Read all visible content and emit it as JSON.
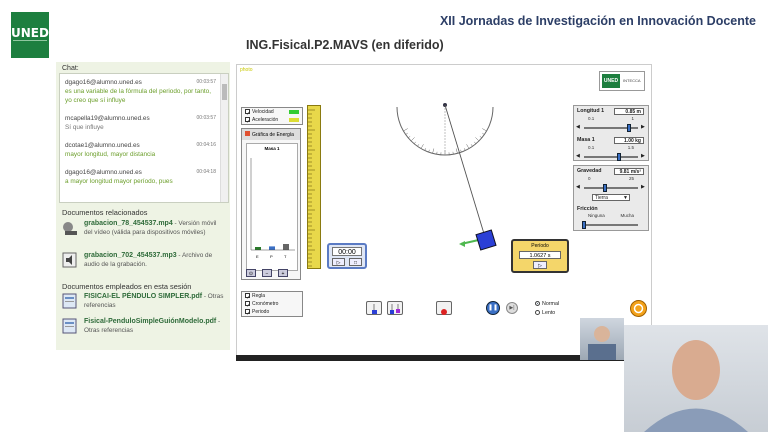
{
  "header": {
    "logo_text": "UNED",
    "event_title": "XII Jornadas de Investigación en Innovación Docente",
    "page_title": "ING.Fisical.P2.MAVS (en diferido)"
  },
  "chat": {
    "label": "Chat:",
    "messages": [
      {
        "user": "dgago16@alumno.uned.es",
        "time": "00:03:57",
        "text": "es una variable de la fórmula del periodo, por tanto, yo creo que sí influye",
        "style": "green"
      },
      {
        "user": "mcapella19@alumno.uned.es",
        "time": "00:03:57",
        "text": "Sí que influye",
        "style": "gray"
      },
      {
        "user": "dcotae1@alumno.uned.es",
        "time": "00:04:16",
        "text": "mayor longitud, mayor distancia",
        "style": "green"
      },
      {
        "user": "dgago16@alumno.uned.es",
        "time": "00:04:18",
        "text": "a mayor longitud mayor período, pues",
        "style": "green"
      }
    ]
  },
  "related_docs": {
    "title": "Documentos relacionados",
    "items": [
      {
        "name": "grabacion_78_454537.mp4",
        "desc": " - Versión móvil del vídeo (válida para dispositivos móviles)",
        "icon": "video-file-icon"
      },
      {
        "name": "grabacion_702_454537.mp3",
        "desc": " - Archivo de audio de la grabación.",
        "icon": "audio-file-icon"
      }
    ]
  },
  "session_docs": {
    "title": "Documentos empleados en esta sesión",
    "items": [
      {
        "name": "FISICAI-EL PÉNDULO SIMPLER.pdf",
        "desc": " - Otras referencias",
        "icon": "pdf-file-icon"
      },
      {
        "name": "Fisical-PenduloSimpleGuiónModelo.pdf",
        "desc": " - Otras referencias",
        "icon": "pdf-file-icon"
      }
    ]
  },
  "simulation": {
    "corner_text": "photo",
    "logo_a": "UNED",
    "logo_b": "INTECCA",
    "vectors": [
      {
        "label": "Velocidad",
        "checked": true,
        "color": "#33cc33"
      },
      {
        "label": "Aceleración",
        "checked": true,
        "color": "#dddd33"
      }
    ],
    "energy": {
      "label": "Gráfica de Energía",
      "plot_title": "Masa 1",
      "bars": [
        {
          "label": "E",
          "value": 0.05
        },
        {
          "label": "P",
          "value": 0.06
        },
        {
          "label": "T",
          "value": 0.1
        }
      ]
    },
    "tools": [
      {
        "label": "Regla",
        "checked": true
      },
      {
        "label": "Cronómetro",
        "checked": true
      },
      {
        "label": "Periodo",
        "checked": true
      }
    ],
    "timer": {
      "display": "00:00",
      "btn_start": "▷",
      "btn_reset": "□"
    },
    "period": {
      "label": "Período",
      "value": "1.0627 s",
      "btn": "▷"
    },
    "length": {
      "label": "Longitud 1",
      "value": "0.85 m",
      "min": "0.1",
      "max": "1",
      "fraction": 0.83
    },
    "mass": {
      "label": "Masa 1",
      "value": "1.00 kg",
      "min": "0.1",
      "max": "1.5",
      "fraction": 0.64
    },
    "gravity": {
      "label": "Gravedad",
      "value": "9.81 m/s²",
      "min": "0",
      "max": "25",
      "fraction": 0.39,
      "select": "Tierra"
    },
    "friction": {
      "label": "Fricción",
      "min": "Ninguna",
      "max": "Mucha",
      "fraction": 0.0
    },
    "speed_options": [
      {
        "label": "Normal",
        "selected": true
      },
      {
        "label": "Lento",
        "selected": false
      }
    ]
  },
  "colors": {
    "accent": "#1d7f3f",
    "event": "#2c3e66",
    "chat_green": "#6b9e2a"
  }
}
